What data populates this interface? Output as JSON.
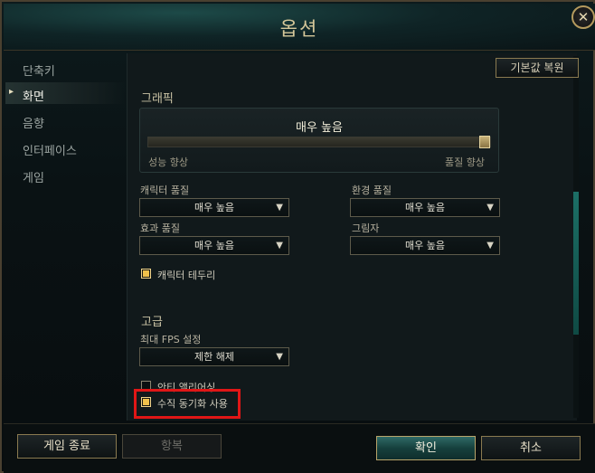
{
  "window": {
    "title": "옵션",
    "close_glyph": "✕"
  },
  "sidebar": {
    "items": [
      {
        "label": "단축키",
        "active": false
      },
      {
        "label": "화면",
        "active": true
      },
      {
        "label": "음향",
        "active": false
      },
      {
        "label": "인터페이스",
        "active": false
      },
      {
        "label": "게임",
        "active": false
      }
    ],
    "active_marker": "▸"
  },
  "toolbar": {
    "reset_label": "기본값 복원"
  },
  "graphics": {
    "section_title": "그래픽",
    "slider": {
      "value_label": "매우 높음",
      "level": 1.0,
      "min_label": "성능 향상",
      "max_label": "품질 향상"
    },
    "character_quality": {
      "label": "캐릭터 품질",
      "value": "매우 높음"
    },
    "environment_quality": {
      "label": "환경 품질",
      "value": "매우 높음"
    },
    "effects_quality": {
      "label": "효과 품질",
      "value": "매우 높음"
    },
    "shadows": {
      "label": "그림자",
      "value": "매우 높음"
    },
    "character_outline": {
      "label": "캐릭터 테두리",
      "checked": true
    }
  },
  "advanced": {
    "section_title": "고급",
    "fps": {
      "label": "최대 FPS 설정",
      "value": "제한 해제"
    },
    "anti_aliasing": {
      "label": "안티 앨리어싱",
      "checked": false
    },
    "vsync": {
      "label": "수직 동기화 사용",
      "checked": true
    }
  },
  "footer": {
    "quit_label": "게임 종료",
    "restore_label": "항복",
    "ok_label": "확인",
    "cancel_label": "취소"
  },
  "colors": {
    "accent_gold": "#d6c89a",
    "highlight_red": "#e01616",
    "checkbox_on": "#e7b73c"
  }
}
